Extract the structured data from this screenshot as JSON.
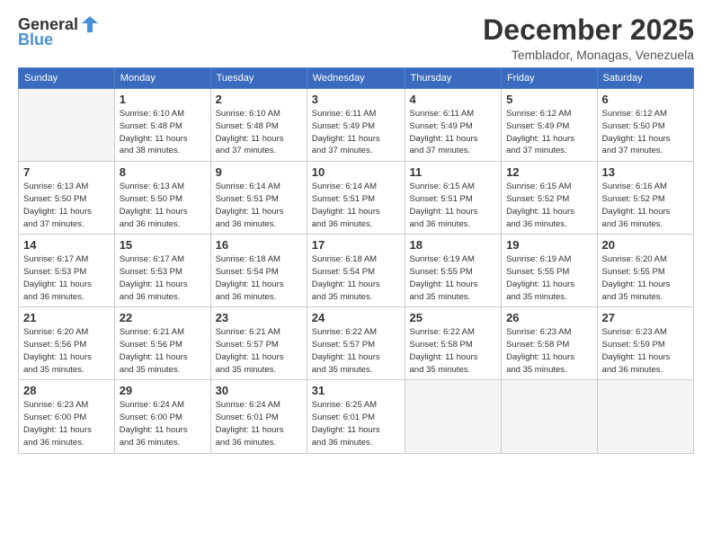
{
  "logo": {
    "general": "General",
    "blue": "Blue"
  },
  "title": "December 2025",
  "location": "Temblador, Monagas, Venezuela",
  "days_of_week": [
    "Sunday",
    "Monday",
    "Tuesday",
    "Wednesday",
    "Thursday",
    "Friday",
    "Saturday"
  ],
  "weeks": [
    [
      {
        "day": "",
        "info": ""
      },
      {
        "day": "1",
        "info": "Sunrise: 6:10 AM\nSunset: 5:48 PM\nDaylight: 11 hours\nand 38 minutes."
      },
      {
        "day": "2",
        "info": "Sunrise: 6:10 AM\nSunset: 5:48 PM\nDaylight: 11 hours\nand 37 minutes."
      },
      {
        "day": "3",
        "info": "Sunrise: 6:11 AM\nSunset: 5:49 PM\nDaylight: 11 hours\nand 37 minutes."
      },
      {
        "day": "4",
        "info": "Sunrise: 6:11 AM\nSunset: 5:49 PM\nDaylight: 11 hours\nand 37 minutes."
      },
      {
        "day": "5",
        "info": "Sunrise: 6:12 AM\nSunset: 5:49 PM\nDaylight: 11 hours\nand 37 minutes."
      },
      {
        "day": "6",
        "info": "Sunrise: 6:12 AM\nSunset: 5:50 PM\nDaylight: 11 hours\nand 37 minutes."
      }
    ],
    [
      {
        "day": "7",
        "info": "Sunrise: 6:13 AM\nSunset: 5:50 PM\nDaylight: 11 hours\nand 37 minutes."
      },
      {
        "day": "8",
        "info": "Sunrise: 6:13 AM\nSunset: 5:50 PM\nDaylight: 11 hours\nand 36 minutes."
      },
      {
        "day": "9",
        "info": "Sunrise: 6:14 AM\nSunset: 5:51 PM\nDaylight: 11 hours\nand 36 minutes."
      },
      {
        "day": "10",
        "info": "Sunrise: 6:14 AM\nSunset: 5:51 PM\nDaylight: 11 hours\nand 36 minutes."
      },
      {
        "day": "11",
        "info": "Sunrise: 6:15 AM\nSunset: 5:51 PM\nDaylight: 11 hours\nand 36 minutes."
      },
      {
        "day": "12",
        "info": "Sunrise: 6:15 AM\nSunset: 5:52 PM\nDaylight: 11 hours\nand 36 minutes."
      },
      {
        "day": "13",
        "info": "Sunrise: 6:16 AM\nSunset: 5:52 PM\nDaylight: 11 hours\nand 36 minutes."
      }
    ],
    [
      {
        "day": "14",
        "info": "Sunrise: 6:17 AM\nSunset: 5:53 PM\nDaylight: 11 hours\nand 36 minutes."
      },
      {
        "day": "15",
        "info": "Sunrise: 6:17 AM\nSunset: 5:53 PM\nDaylight: 11 hours\nand 36 minutes."
      },
      {
        "day": "16",
        "info": "Sunrise: 6:18 AM\nSunset: 5:54 PM\nDaylight: 11 hours\nand 36 minutes."
      },
      {
        "day": "17",
        "info": "Sunrise: 6:18 AM\nSunset: 5:54 PM\nDaylight: 11 hours\nand 35 minutes."
      },
      {
        "day": "18",
        "info": "Sunrise: 6:19 AM\nSunset: 5:55 PM\nDaylight: 11 hours\nand 35 minutes."
      },
      {
        "day": "19",
        "info": "Sunrise: 6:19 AM\nSunset: 5:55 PM\nDaylight: 11 hours\nand 35 minutes."
      },
      {
        "day": "20",
        "info": "Sunrise: 6:20 AM\nSunset: 5:55 PM\nDaylight: 11 hours\nand 35 minutes."
      }
    ],
    [
      {
        "day": "21",
        "info": "Sunrise: 6:20 AM\nSunset: 5:56 PM\nDaylight: 11 hours\nand 35 minutes."
      },
      {
        "day": "22",
        "info": "Sunrise: 6:21 AM\nSunset: 5:56 PM\nDaylight: 11 hours\nand 35 minutes."
      },
      {
        "day": "23",
        "info": "Sunrise: 6:21 AM\nSunset: 5:57 PM\nDaylight: 11 hours\nand 35 minutes."
      },
      {
        "day": "24",
        "info": "Sunrise: 6:22 AM\nSunset: 5:57 PM\nDaylight: 11 hours\nand 35 minutes."
      },
      {
        "day": "25",
        "info": "Sunrise: 6:22 AM\nSunset: 5:58 PM\nDaylight: 11 hours\nand 35 minutes."
      },
      {
        "day": "26",
        "info": "Sunrise: 6:23 AM\nSunset: 5:58 PM\nDaylight: 11 hours\nand 35 minutes."
      },
      {
        "day": "27",
        "info": "Sunrise: 6:23 AM\nSunset: 5:59 PM\nDaylight: 11 hours\nand 36 minutes."
      }
    ],
    [
      {
        "day": "28",
        "info": "Sunrise: 6:23 AM\nSunset: 6:00 PM\nDaylight: 11 hours\nand 36 minutes."
      },
      {
        "day": "29",
        "info": "Sunrise: 6:24 AM\nSunset: 6:00 PM\nDaylight: 11 hours\nand 36 minutes."
      },
      {
        "day": "30",
        "info": "Sunrise: 6:24 AM\nSunset: 6:01 PM\nDaylight: 11 hours\nand 36 minutes."
      },
      {
        "day": "31",
        "info": "Sunrise: 6:25 AM\nSunset: 6:01 PM\nDaylight: 11 hours\nand 36 minutes."
      },
      {
        "day": "",
        "info": ""
      },
      {
        "day": "",
        "info": ""
      },
      {
        "day": "",
        "info": ""
      }
    ]
  ]
}
